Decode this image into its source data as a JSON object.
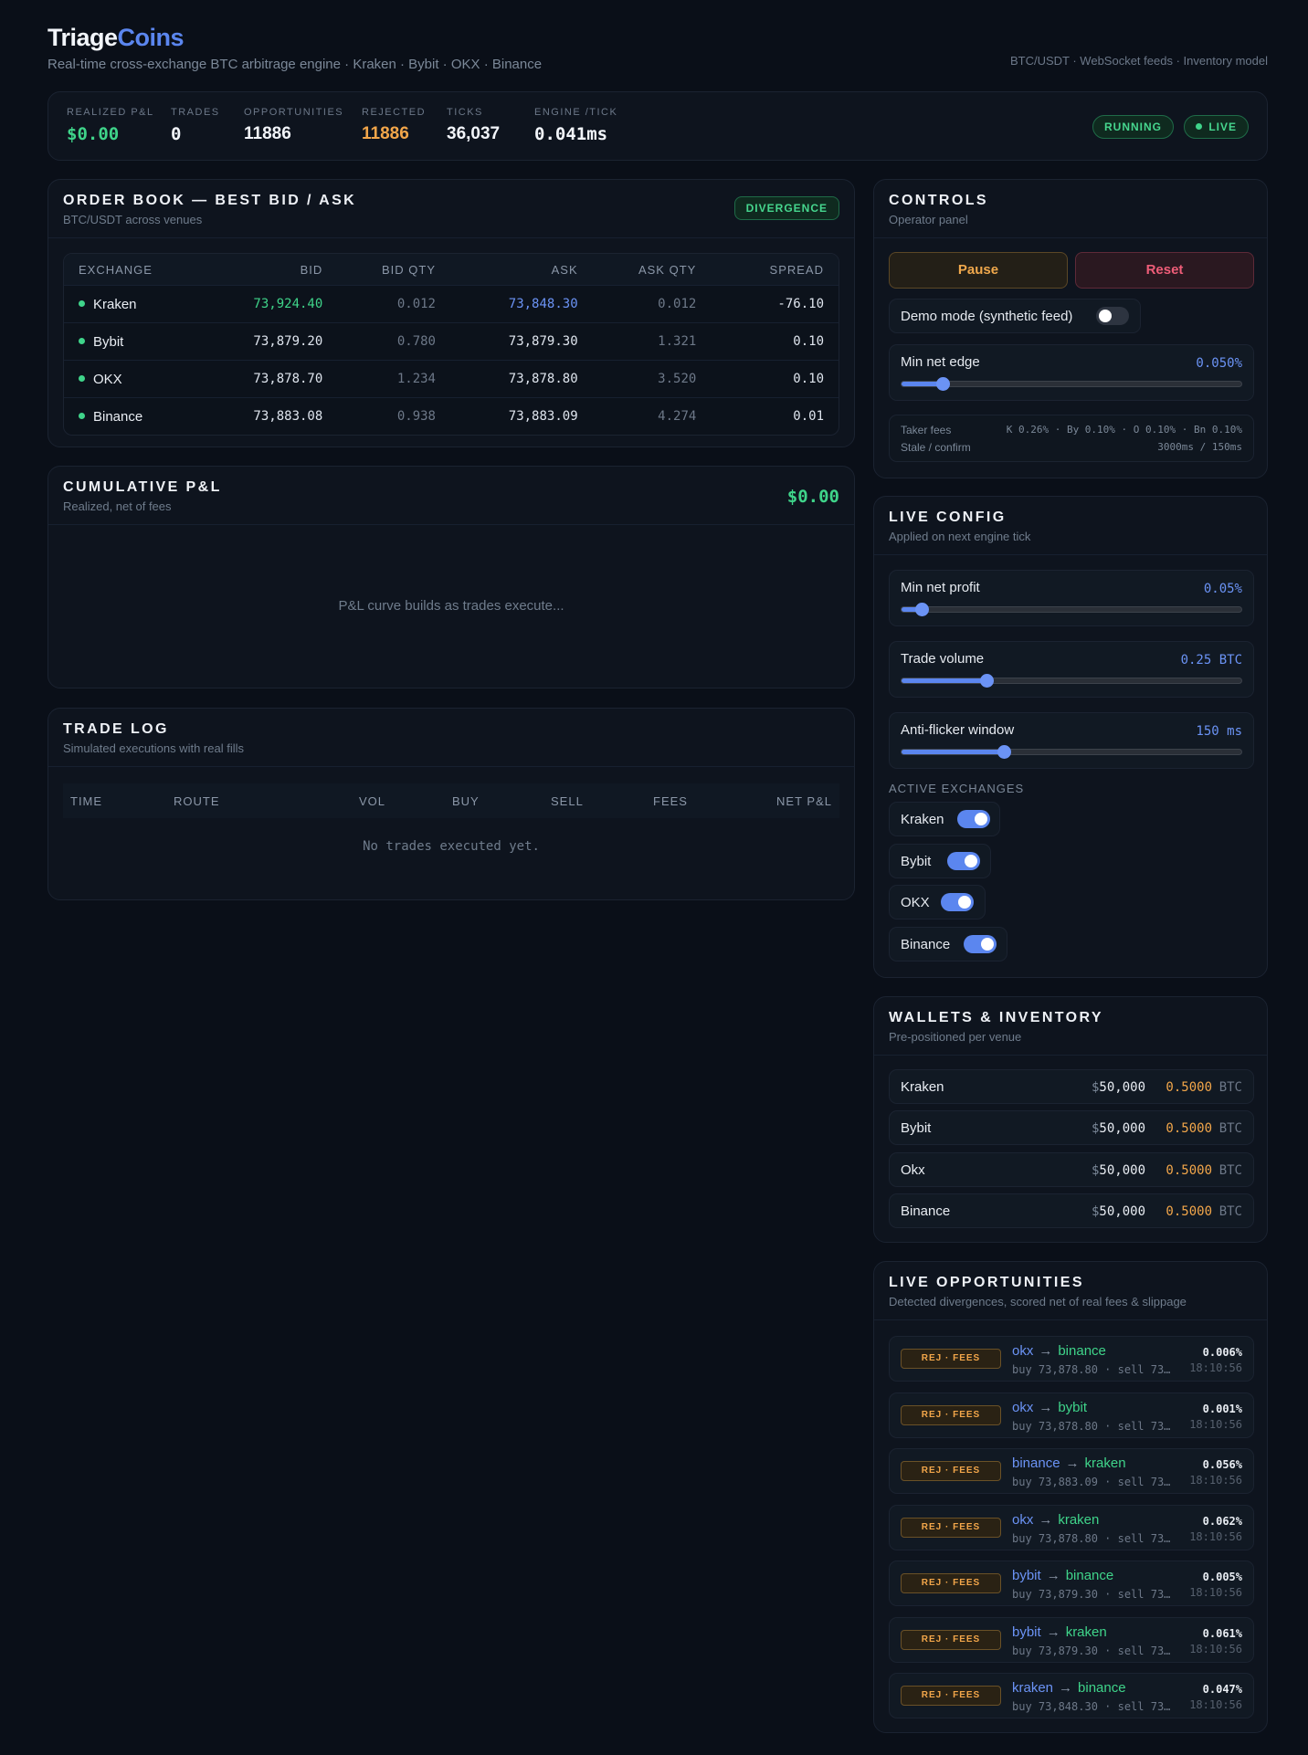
{
  "brand": {
    "name_a": "Triage",
    "name_b": "Coins",
    "tagline": "Real-time cross-exchange BTC arbitrage engine · Kraken · Bybit · OKX · Binance",
    "meta": "BTC/USDT · WebSocket feeds · Inventory model"
  },
  "stats": {
    "realized_label": "REALIZED P&L",
    "realized": "$0.00",
    "trades_label": "TRADES",
    "trades": "0",
    "opps_label": "OPPORTUNITIES",
    "opps": "11886",
    "rejected_label": "REJECTED",
    "rejected": "11886",
    "ticks_label": "TICKS",
    "ticks": "36,037",
    "engine_label": "ENGINE /TICK",
    "engine": "0.041ms",
    "running": "RUNNING",
    "live": "LIVE"
  },
  "orderbook": {
    "title": "ORDER BOOK — BEST BID / ASK",
    "subtitle": "BTC/USDT across venues",
    "badge": "DIVERGENCE",
    "headers": [
      "EXCHANGE",
      "BID",
      "BID QTY",
      "ASK",
      "ASK QTY",
      "SPREAD"
    ],
    "rows": [
      {
        "ex": "Kraken",
        "bid": "73,924.40",
        "bid_qty": "0.012",
        "ask": "73,848.30",
        "ask_qty": "0.012",
        "spread": "-76.10"
      },
      {
        "ex": "Bybit",
        "bid": "73,879.20",
        "bid_qty": "0.780",
        "ask": "73,879.30",
        "ask_qty": "1.321",
        "spread": "0.10"
      },
      {
        "ex": "OKX",
        "bid": "73,878.70",
        "bid_qty": "1.234",
        "ask": "73,878.80",
        "ask_qty": "3.520",
        "spread": "0.10"
      },
      {
        "ex": "Binance",
        "bid": "73,883.08",
        "bid_qty": "0.938",
        "ask": "73,883.09",
        "ask_qty": "4.274",
        "spread": "0.01"
      }
    ]
  },
  "pnl": {
    "title": "CUMULATIVE P&L",
    "subtitle": "Realized, net of fees",
    "total": "$0.00",
    "empty": "P&L curve builds as trades execute..."
  },
  "tradelog": {
    "title": "TRADE LOG",
    "subtitle": "Simulated executions with real fills",
    "headers": [
      "TIME",
      "ROUTE",
      "VOL",
      "BUY",
      "SELL",
      "FEES",
      "NET P&L"
    ],
    "empty": "No trades executed yet."
  },
  "controls": {
    "title": "CONTROLS",
    "subtitle": "Operator panel",
    "pause": "Pause",
    "reset": "Reset",
    "demo_label": "Demo mode (synthetic feed)",
    "demo_on": false,
    "min_edge_label": "Min net edge",
    "min_edge_value": "0.050%",
    "min_edge_fraction": 0.12,
    "fees_label": "Taker fees",
    "fees_value": "K 0.26% · By 0.10% · O 0.10% · Bn 0.10%",
    "stale_label": "Stale / confirm",
    "stale_value": "3000ms / 150ms"
  },
  "liveconfig": {
    "title": "LIVE CONFIG",
    "subtitle": "Applied on next engine tick",
    "sliders": [
      {
        "label": "Min net profit",
        "value": "0.05%",
        "fraction": 0.06
      },
      {
        "label": "Trade volume",
        "value": "0.25 BTC",
        "fraction": 0.25
      },
      {
        "label": "Anti-flicker window",
        "value": "150 ms",
        "fraction": 0.3
      }
    ],
    "active_label": "ACTIVE EXCHANGES",
    "exchanges": [
      {
        "name": "Kraken",
        "on": true
      },
      {
        "name": "Bybit",
        "on": true
      },
      {
        "name": "OKX",
        "on": true
      },
      {
        "name": "Binance",
        "on": true
      }
    ]
  },
  "wallets": {
    "title": "WALLETS & INVENTORY",
    "subtitle": "Pre-positioned per venue",
    "rows": [
      {
        "name": "Kraken",
        "usd_sign": "$",
        "usd": "50,000",
        "btc": "0.5000",
        "unit": "BTC"
      },
      {
        "name": "Bybit",
        "usd_sign": "$",
        "usd": "50,000",
        "btc": "0.5000",
        "unit": "BTC"
      },
      {
        "name": "Okx",
        "usd_sign": "$",
        "usd": "50,000",
        "btc": "0.5000",
        "unit": "BTC"
      },
      {
        "name": "Binance",
        "usd_sign": "$",
        "usd": "50,000",
        "btc": "0.5000",
        "unit": "BTC"
      }
    ]
  },
  "opps": {
    "title": "LIVE OPPORTUNITIES",
    "subtitle": "Detected divergences, scored net of real fees & slippage",
    "rows": [
      {
        "status": "REJ · FEES",
        "from": "okx",
        "to": "binance",
        "arrow": "→",
        "info": "buy 73,878.80 · sell 73…",
        "pct": "0.006%",
        "time": "18:10:56"
      },
      {
        "status": "REJ · FEES",
        "from": "okx",
        "to": "bybit",
        "arrow": "→",
        "info": "buy 73,878.80 · sell 73…",
        "pct": "0.001%",
        "time": "18:10:56"
      },
      {
        "status": "REJ · FEES",
        "from": "binance",
        "to": "kraken",
        "arrow": "→",
        "info": "buy 73,883.09 · sell 73…",
        "pct": "0.056%",
        "time": "18:10:56"
      },
      {
        "status": "REJ · FEES",
        "from": "okx",
        "to": "kraken",
        "arrow": "→",
        "info": "buy 73,878.80 · sell 73…",
        "pct": "0.062%",
        "time": "18:10:56"
      },
      {
        "status": "REJ · FEES",
        "from": "bybit",
        "to": "binance",
        "arrow": "→",
        "info": "buy 73,879.30 · sell 73…",
        "pct": "0.005%",
        "time": "18:10:56"
      },
      {
        "status": "REJ · FEES",
        "from": "bybit",
        "to": "kraken",
        "arrow": "→",
        "info": "buy 73,879.30 · sell 73…",
        "pct": "0.061%",
        "time": "18:10:56"
      },
      {
        "status": "REJ · FEES",
        "from": "kraken",
        "to": "binance",
        "arrow": "→",
        "info": "buy 73,848.30 · sell 73…",
        "pct": "0.047%",
        "time": "18:10:56"
      }
    ]
  }
}
